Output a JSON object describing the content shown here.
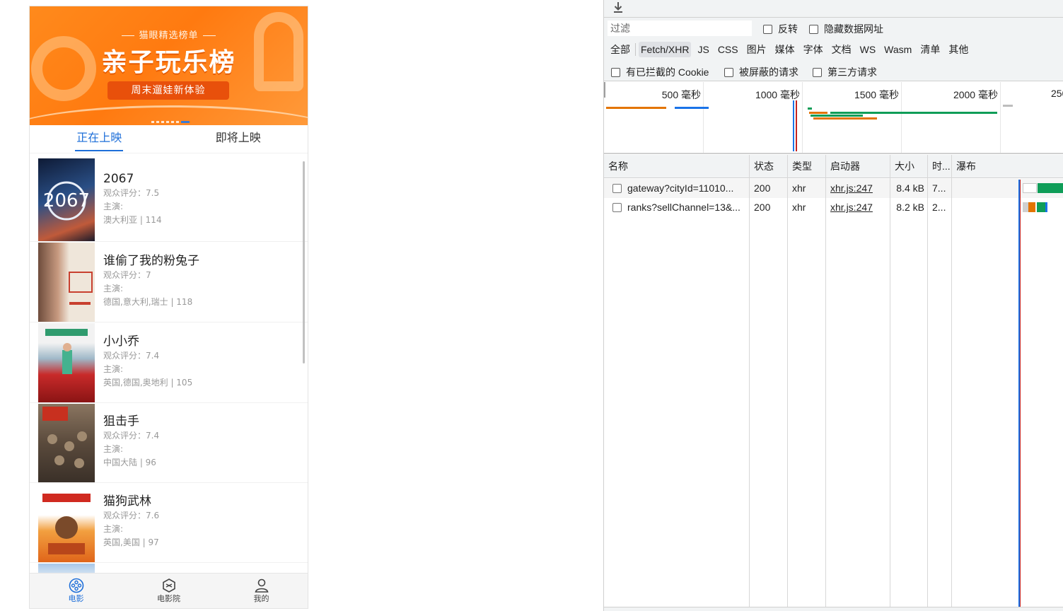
{
  "phone": {
    "banner": {
      "kicker": "猫眼精选榜单",
      "headline": "亲子玩乐榜",
      "ribbon": "周末遛娃新体验"
    },
    "tabs": [
      {
        "label": "正在上映",
        "active": true
      },
      {
        "label": "即将上映",
        "active": false
      }
    ],
    "movies": [
      {
        "title": "2067",
        "score_line": "观众评分：7.5",
        "actors_line": "主演:",
        "meta_line": "澳大利亚 | 114",
        "poster_colors": [
          "#1b2a4a",
          "#3a5a8c",
          "#9b3a2e"
        ]
      },
      {
        "title": "谁偷了我的粉兔子",
        "score_line": "观众评分：7",
        "actors_line": "主演:",
        "meta_line": "德国,意大利,瑞士 | 118",
        "poster_colors": [
          "#e9e0d4",
          "#7a5a48",
          "#c8402f"
        ]
      },
      {
        "title": "小小乔",
        "score_line": "观众评分：7.4",
        "actors_line": "主演:",
        "meta_line": "英国,德国,奥地利 | 105",
        "poster_colors": [
          "#f3f3f3",
          "#3aa07a",
          "#c8242a"
        ]
      },
      {
        "title": "狙击手",
        "score_line": "观众评分：7.4",
        "actors_line": "主演:",
        "meta_line": "中国大陆 | 96",
        "poster_colors": [
          "#7a6a58",
          "#4a4035",
          "#b8a080"
        ]
      },
      {
        "title": "猫狗武林",
        "score_line": "观众评分：7.6",
        "actors_line": "主演:",
        "meta_line": "英国,美国 | 97",
        "poster_colors": [
          "#ffffff",
          "#e8741e",
          "#d02a20"
        ]
      }
    ],
    "bottom_nav": [
      {
        "label": "电影",
        "icon": "film-reel-icon",
        "active": true
      },
      {
        "label": "电影院",
        "icon": "cinema-icon",
        "active": false
      },
      {
        "label": "我的",
        "icon": "user-icon",
        "active": false
      }
    ]
  },
  "devtools": {
    "filter": {
      "placeholder": "过滤",
      "value": ""
    },
    "checkboxes_row1": [
      "反转",
      "隐藏数据网址"
    ],
    "type_filters": [
      "全部",
      "Fetch/XHR",
      "JS",
      "CSS",
      "图片",
      "媒体",
      "字体",
      "文档",
      "WS",
      "Wasm",
      "清单",
      "其他"
    ],
    "active_type": "Fetch/XHR",
    "checkboxes_row2": [
      "有已拦截的 Cookie",
      "被屏蔽的请求",
      "第三方请求"
    ],
    "timeline_labels": [
      "500 毫秒",
      "1000 毫秒",
      "1500 毫秒",
      "2000 毫秒",
      "250"
    ],
    "columns": [
      "名称",
      "状态",
      "类型",
      "启动器",
      "大小",
      "时...",
      "瀑布"
    ],
    "rows": [
      {
        "name": "gateway?cityId=11010...",
        "status": "200",
        "type": "xhr",
        "initiator": "xhr.js:247",
        "size": "8.4 kB",
        "time": "7..."
      },
      {
        "name": "ranks?sellChannel=13&...",
        "status": "200",
        "type": "xhr",
        "initiator": "xhr.js:247",
        "size": "8.2 kB",
        "time": "2..."
      }
    ],
    "colors": {
      "waiting": "#0f9d58",
      "dns": "#e37400",
      "blue_line": "#1a73e8",
      "red_line": "#c5221f"
    }
  }
}
